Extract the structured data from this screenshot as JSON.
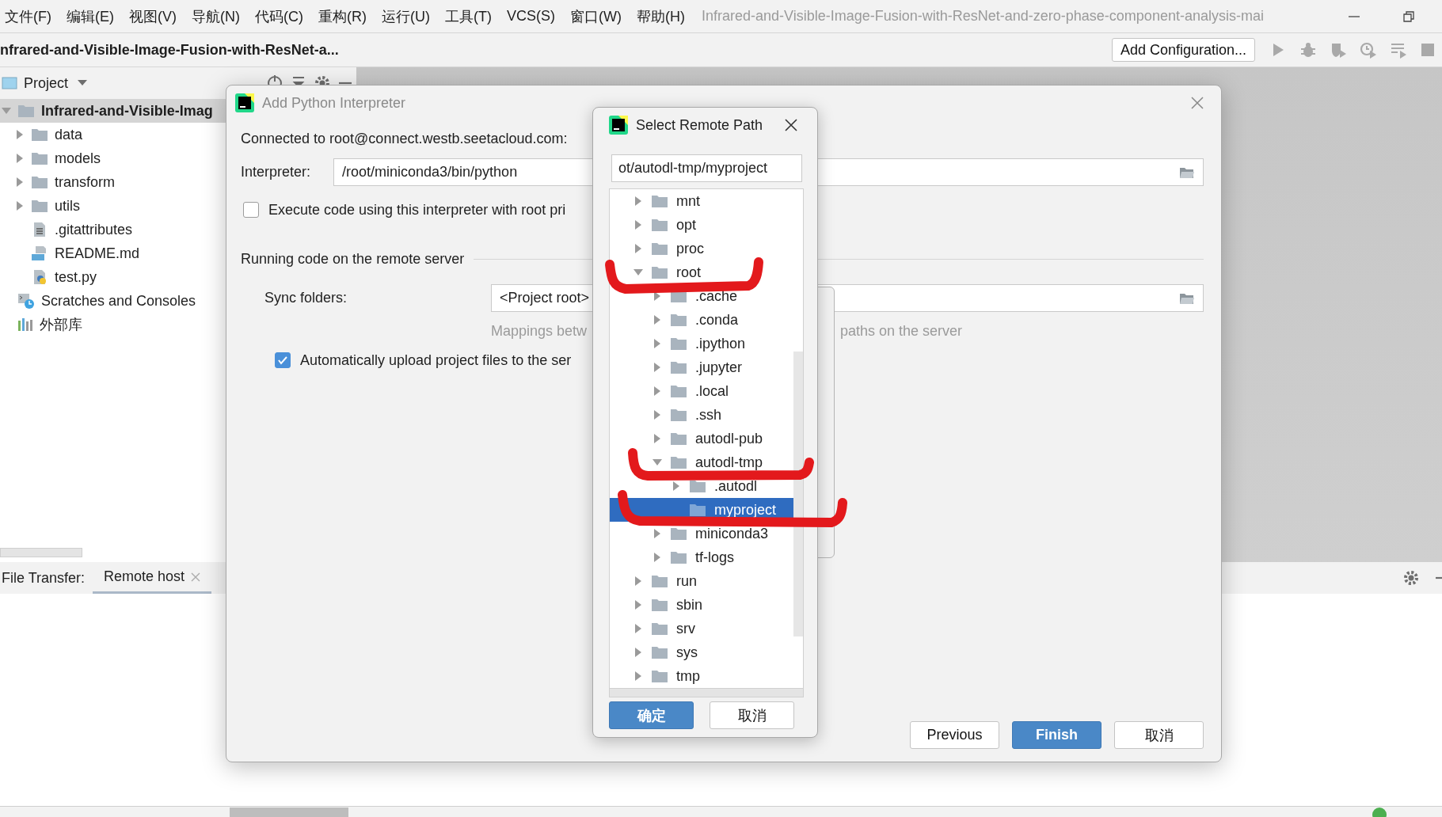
{
  "menu": [
    "文件(F)",
    "编辑(E)",
    "视图(V)",
    "导航(N)",
    "代码(C)",
    "重构(R)",
    "运行(U)",
    "工具(T)",
    "VCS(S)",
    "窗口(W)",
    "帮助(H)"
  ],
  "window_title": "Infrared-and-Visible-Image-Fusion-with-ResNet-and-zero-phase-component-analysis-mai",
  "navbar": {
    "breadcrumb": "nfrared-and-Visible-Image-Fusion-with-ResNet-a...",
    "run_config_button": "Add Configuration..."
  },
  "project_panel": {
    "title": "Project",
    "tree": [
      {
        "label": "Infrared-and-Visible-Imag",
        "kind": "folder",
        "expanded": true,
        "selected": true,
        "children": [
          {
            "label": "data",
            "kind": "folder",
            "expanded": false,
            "selected": false
          },
          {
            "label": "models",
            "kind": "folder",
            "expanded": false,
            "selected": false
          },
          {
            "label": "transform",
            "kind": "folder",
            "expanded": false,
            "selected": false
          },
          {
            "label": "utils",
            "kind": "folder",
            "expanded": false,
            "selected": false
          },
          {
            "label": ".gitattributes",
            "kind": "text-file",
            "selected": false
          },
          {
            "label": "README.md",
            "kind": "markdown",
            "selected": false
          },
          {
            "label": "test.py",
            "kind": "python",
            "selected": false
          }
        ]
      },
      {
        "label": "Scratches and Consoles",
        "kind": "scratches",
        "selected": false
      },
      {
        "label": "外部库",
        "kind": "library",
        "selected": false
      }
    ]
  },
  "file_transfer": {
    "label": "File Transfer:",
    "tabs": [
      {
        "label": "Remote host",
        "selected": true
      }
    ]
  },
  "interpreter_dialog": {
    "title": "Add Python Interpreter",
    "connection": "Connected to root@connect.westb.seetacloud.com:",
    "interpreter": {
      "label": "Interpreter:",
      "value": "/root/miniconda3/bin/python"
    },
    "root_option": {
      "label": "Execute code using this interpreter with root pri",
      "checked": false
    },
    "section": "Running code on the remote server",
    "sync": {
      "label": "Sync folders:",
      "value": "<Project root>"
    },
    "hint": [
      "Mappings betw",
      "paths on the server"
    ],
    "upload_option": {
      "label": "Automatically upload project files to the ser",
      "checked": true
    },
    "buttons": [
      {
        "label": "Previous",
        "kind": "default"
      },
      {
        "label": "Finish",
        "kind": "primary"
      },
      {
        "label": "取消",
        "kind": "default"
      }
    ]
  },
  "remote_path_dialog": {
    "title": "Select Remote Path",
    "path": "ot/autodl-tmp/myproject",
    "tree": [
      {
        "label": "mnt",
        "kind": "folder",
        "expanded": false,
        "selected": false
      },
      {
        "label": "opt",
        "kind": "folder",
        "expanded": false,
        "selected": false
      },
      {
        "label": "proc",
        "kind": "folder",
        "expanded": false,
        "selected": false
      },
      {
        "label": "root",
        "kind": "folder",
        "expanded": true,
        "selected": false,
        "children": [
          {
            "label": ".cache",
            "kind": "folder",
            "expanded": false,
            "selected": false
          },
          {
            "label": ".conda",
            "kind": "folder",
            "expanded": false,
            "selected": false
          },
          {
            "label": ".ipython",
            "kind": "folder",
            "expanded": false,
            "selected": false
          },
          {
            "label": ".jupyter",
            "kind": "folder",
            "expanded": false,
            "selected": false
          },
          {
            "label": ".local",
            "kind": "folder",
            "expanded": false,
            "selected": false
          },
          {
            "label": ".ssh",
            "kind": "folder",
            "expanded": false,
            "selected": false
          },
          {
            "label": "autodl-pub",
            "kind": "folder",
            "expanded": false,
            "selected": false
          },
          {
            "label": "autodl-tmp",
            "kind": "folder",
            "expanded": true,
            "selected": false,
            "children": [
              {
                "label": ".autodl",
                "kind": "folder",
                "expanded": false,
                "selected": false
              },
              {
                "label": "myproject",
                "kind": "folder",
                "selected": true
              }
            ]
          },
          {
            "label": "miniconda3",
            "kind": "folder",
            "expanded": false,
            "selected": false
          },
          {
            "label": "tf-logs",
            "kind": "folder",
            "expanded": false,
            "selected": false
          }
        ]
      },
      {
        "label": "run",
        "kind": "folder",
        "expanded": false,
        "selected": false
      },
      {
        "label": "sbin",
        "kind": "folder",
        "expanded": false,
        "selected": false
      },
      {
        "label": "srv",
        "kind": "folder",
        "expanded": false,
        "selected": false
      },
      {
        "label": "sys",
        "kind": "folder",
        "expanded": false,
        "selected": false
      },
      {
        "label": "tmp",
        "kind": "folder",
        "expanded": false,
        "selected": false
      }
    ],
    "buttons": [
      {
        "label": "确定",
        "kind": "primary"
      },
      {
        "label": "取消",
        "kind": "default"
      }
    ]
  }
}
